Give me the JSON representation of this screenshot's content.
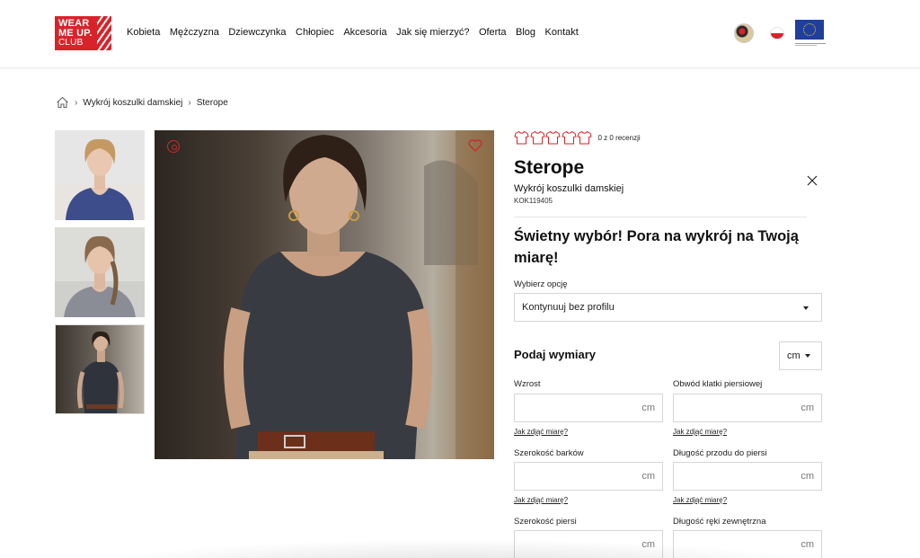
{
  "brand": {
    "logo_line1": "WEAR",
    "logo_line2": "ME UP.",
    "logo_line3": "CLUB"
  },
  "nav": [
    "Kobieta",
    "Mężczyzna",
    "Dziewczynka",
    "Chłopiec",
    "Akcesoria",
    "Jak się mierzyć?",
    "Oferta",
    "Blog",
    "Kontakt"
  ],
  "breadcrumb": [
    "Wykrój koszulki damskiej",
    "Sterope"
  ],
  "product": {
    "rating_text": "0 z 0 recenzji",
    "rating_value": 0,
    "rating_max": 5,
    "name": "Sterope",
    "subtitle": "Wykrój koszulki damskiej",
    "sku": "KOK119405",
    "promo": "Świetny wybór! Pora na wykrój na Twoją miarę!"
  },
  "option": {
    "label": "Wybierz opcję",
    "selected": "Kontynuuj bez profilu"
  },
  "dimensions": {
    "title": "Podaj wymiary",
    "unit": "cm",
    "link_text": "Jak zdjąć miarę?",
    "fields": [
      {
        "label": "Wzrost",
        "unit": "cm"
      },
      {
        "label": "Obwód klatki piersiowej",
        "unit": "cm"
      },
      {
        "label": "Szerokość barków",
        "unit": "cm"
      },
      {
        "label": "Długość przodu do piersi",
        "unit": "cm"
      },
      {
        "label": "Szerokość piersi",
        "unit": "cm"
      },
      {
        "label": "Długość ręki zewnętrzna",
        "unit": "cm"
      }
    ]
  },
  "colors": {
    "accent": "#d8232a",
    "eu_blue": "#1f3f9a"
  }
}
